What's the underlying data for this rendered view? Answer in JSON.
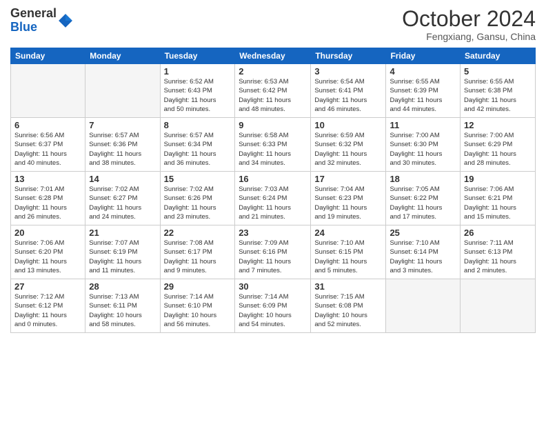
{
  "header": {
    "logo_general": "General",
    "logo_blue": "Blue",
    "title": "October 2024",
    "subtitle": "Fengxiang, Gansu, China"
  },
  "columns": [
    "Sunday",
    "Monday",
    "Tuesday",
    "Wednesday",
    "Thursday",
    "Friday",
    "Saturday"
  ],
  "weeks": [
    [
      {
        "day": "",
        "info": ""
      },
      {
        "day": "",
        "info": ""
      },
      {
        "day": "1",
        "info": "Sunrise: 6:52 AM\nSunset: 6:43 PM\nDaylight: 11 hours\nand 50 minutes."
      },
      {
        "day": "2",
        "info": "Sunrise: 6:53 AM\nSunset: 6:42 PM\nDaylight: 11 hours\nand 48 minutes."
      },
      {
        "day": "3",
        "info": "Sunrise: 6:54 AM\nSunset: 6:41 PM\nDaylight: 11 hours\nand 46 minutes."
      },
      {
        "day": "4",
        "info": "Sunrise: 6:55 AM\nSunset: 6:39 PM\nDaylight: 11 hours\nand 44 minutes."
      },
      {
        "day": "5",
        "info": "Sunrise: 6:55 AM\nSunset: 6:38 PM\nDaylight: 11 hours\nand 42 minutes."
      }
    ],
    [
      {
        "day": "6",
        "info": "Sunrise: 6:56 AM\nSunset: 6:37 PM\nDaylight: 11 hours\nand 40 minutes."
      },
      {
        "day": "7",
        "info": "Sunrise: 6:57 AM\nSunset: 6:36 PM\nDaylight: 11 hours\nand 38 minutes."
      },
      {
        "day": "8",
        "info": "Sunrise: 6:57 AM\nSunset: 6:34 PM\nDaylight: 11 hours\nand 36 minutes."
      },
      {
        "day": "9",
        "info": "Sunrise: 6:58 AM\nSunset: 6:33 PM\nDaylight: 11 hours\nand 34 minutes."
      },
      {
        "day": "10",
        "info": "Sunrise: 6:59 AM\nSunset: 6:32 PM\nDaylight: 11 hours\nand 32 minutes."
      },
      {
        "day": "11",
        "info": "Sunrise: 7:00 AM\nSunset: 6:30 PM\nDaylight: 11 hours\nand 30 minutes."
      },
      {
        "day": "12",
        "info": "Sunrise: 7:00 AM\nSunset: 6:29 PM\nDaylight: 11 hours\nand 28 minutes."
      }
    ],
    [
      {
        "day": "13",
        "info": "Sunrise: 7:01 AM\nSunset: 6:28 PM\nDaylight: 11 hours\nand 26 minutes."
      },
      {
        "day": "14",
        "info": "Sunrise: 7:02 AM\nSunset: 6:27 PM\nDaylight: 11 hours\nand 24 minutes."
      },
      {
        "day": "15",
        "info": "Sunrise: 7:02 AM\nSunset: 6:26 PM\nDaylight: 11 hours\nand 23 minutes."
      },
      {
        "day": "16",
        "info": "Sunrise: 7:03 AM\nSunset: 6:24 PM\nDaylight: 11 hours\nand 21 minutes."
      },
      {
        "day": "17",
        "info": "Sunrise: 7:04 AM\nSunset: 6:23 PM\nDaylight: 11 hours\nand 19 minutes."
      },
      {
        "day": "18",
        "info": "Sunrise: 7:05 AM\nSunset: 6:22 PM\nDaylight: 11 hours\nand 17 minutes."
      },
      {
        "day": "19",
        "info": "Sunrise: 7:06 AM\nSunset: 6:21 PM\nDaylight: 11 hours\nand 15 minutes."
      }
    ],
    [
      {
        "day": "20",
        "info": "Sunrise: 7:06 AM\nSunset: 6:20 PM\nDaylight: 11 hours\nand 13 minutes."
      },
      {
        "day": "21",
        "info": "Sunrise: 7:07 AM\nSunset: 6:19 PM\nDaylight: 11 hours\nand 11 minutes."
      },
      {
        "day": "22",
        "info": "Sunrise: 7:08 AM\nSunset: 6:17 PM\nDaylight: 11 hours\nand 9 minutes."
      },
      {
        "day": "23",
        "info": "Sunrise: 7:09 AM\nSunset: 6:16 PM\nDaylight: 11 hours\nand 7 minutes."
      },
      {
        "day": "24",
        "info": "Sunrise: 7:10 AM\nSunset: 6:15 PM\nDaylight: 11 hours\nand 5 minutes."
      },
      {
        "day": "25",
        "info": "Sunrise: 7:10 AM\nSunset: 6:14 PM\nDaylight: 11 hours\nand 3 minutes."
      },
      {
        "day": "26",
        "info": "Sunrise: 7:11 AM\nSunset: 6:13 PM\nDaylight: 11 hours\nand 2 minutes."
      }
    ],
    [
      {
        "day": "27",
        "info": "Sunrise: 7:12 AM\nSunset: 6:12 PM\nDaylight: 11 hours\nand 0 minutes."
      },
      {
        "day": "28",
        "info": "Sunrise: 7:13 AM\nSunset: 6:11 PM\nDaylight: 10 hours\nand 58 minutes."
      },
      {
        "day": "29",
        "info": "Sunrise: 7:14 AM\nSunset: 6:10 PM\nDaylight: 10 hours\nand 56 minutes."
      },
      {
        "day": "30",
        "info": "Sunrise: 7:14 AM\nSunset: 6:09 PM\nDaylight: 10 hours\nand 54 minutes."
      },
      {
        "day": "31",
        "info": "Sunrise: 7:15 AM\nSunset: 6:08 PM\nDaylight: 10 hours\nand 52 minutes."
      },
      {
        "day": "",
        "info": ""
      },
      {
        "day": "",
        "info": ""
      }
    ]
  ]
}
